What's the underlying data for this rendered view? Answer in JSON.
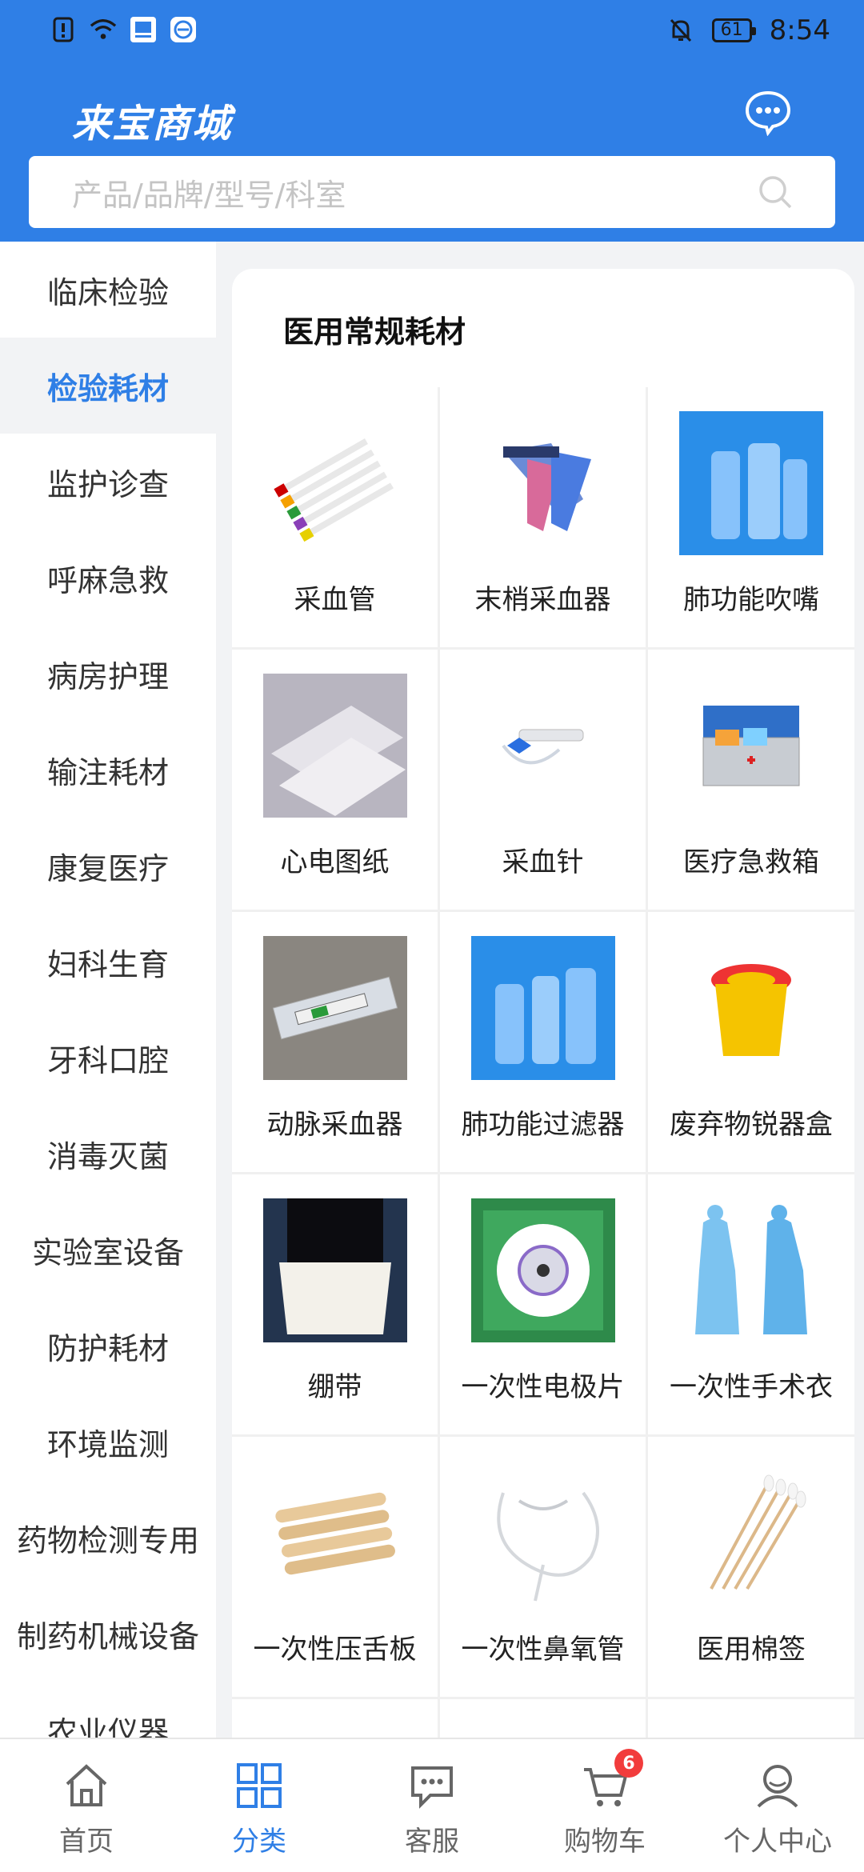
{
  "status_bar": {
    "time": "8:54",
    "battery": "61"
  },
  "header": {
    "brand": "来宝商城"
  },
  "search": {
    "placeholder": "产品/品牌/型号/科室"
  },
  "sidebar": {
    "items": [
      {
        "label": "临床检验"
      },
      {
        "label": "检验耗材"
      },
      {
        "label": "监护诊查"
      },
      {
        "label": "呼麻急救"
      },
      {
        "label": "病房护理"
      },
      {
        "label": "输注耗材"
      },
      {
        "label": "康复医疗"
      },
      {
        "label": "妇科生育"
      },
      {
        "label": "牙科口腔"
      },
      {
        "label": "消毒灭菌"
      },
      {
        "label": "实验室设备"
      },
      {
        "label": "防护耗材"
      },
      {
        "label": "环境监测"
      },
      {
        "label": "药物检测专用"
      },
      {
        "label": "制药机械设备"
      },
      {
        "label": "农业仪器"
      }
    ]
  },
  "content": {
    "title": "医用常规耗材",
    "products": [
      {
        "label": "采血管"
      },
      {
        "label": "末梢采血器"
      },
      {
        "label": "肺功能吹嘴"
      },
      {
        "label": "心电图纸"
      },
      {
        "label": "采血针"
      },
      {
        "label": "医疗急救箱"
      },
      {
        "label": "动脉采血器"
      },
      {
        "label": "肺功能过滤器"
      },
      {
        "label": "废弃物锐器盒"
      },
      {
        "label": "绷带"
      },
      {
        "label": "一次性电极片"
      },
      {
        "label": "一次性手术衣"
      },
      {
        "label": "一次性压舌板"
      },
      {
        "label": "一次性鼻氧管"
      },
      {
        "label": "医用棉签"
      }
    ]
  },
  "tabbar": {
    "tabs": [
      {
        "label": "首页"
      },
      {
        "label": "分类"
      },
      {
        "label": "客服"
      },
      {
        "label": "购物车"
      },
      {
        "label": "个人中心"
      }
    ],
    "cart_badge": "6"
  },
  "colors": {
    "accent": "#2f7fe6",
    "badge": "#f23c3c"
  }
}
